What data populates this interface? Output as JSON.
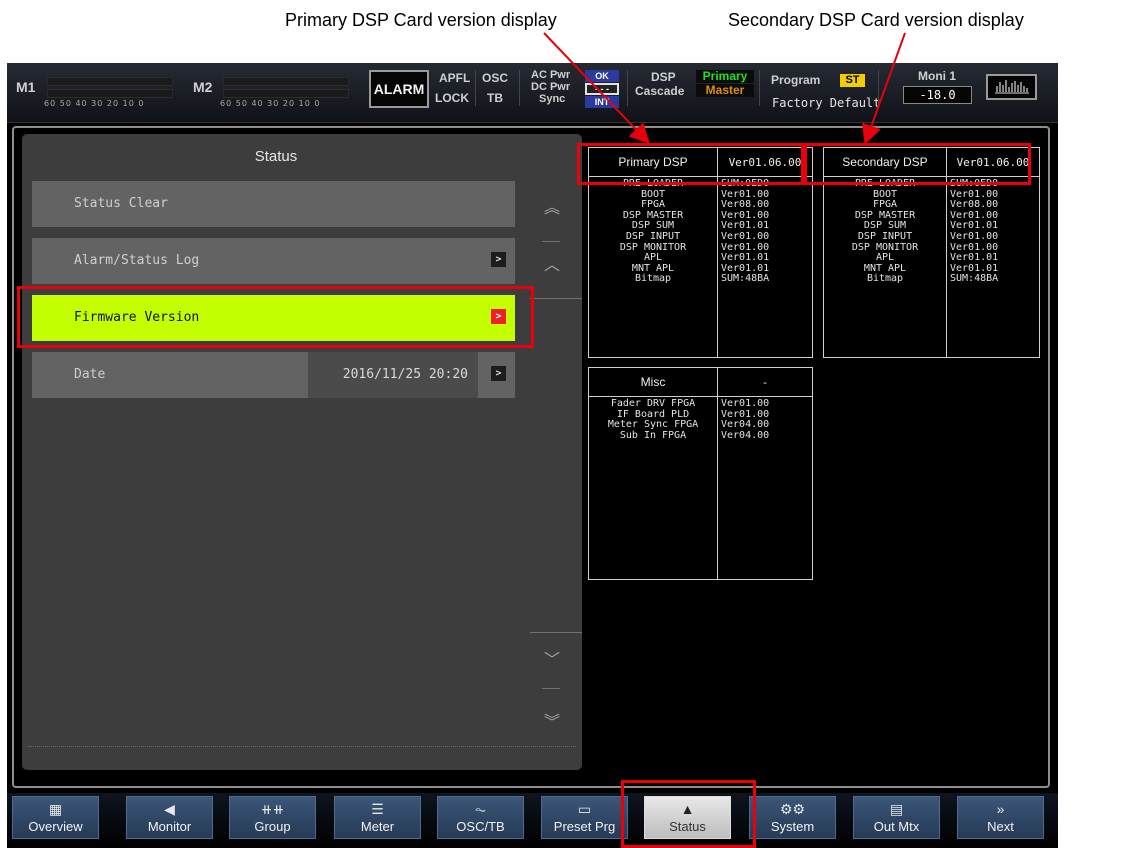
{
  "annotations": {
    "primary_label": "Primary DSP Card version display",
    "secondary_label": "Secondary DSP Card version display"
  },
  "header": {
    "m1": "M1",
    "m2": "M2",
    "meter_scale": "60 50 40 30 20 10  0",
    "alarm": "ALARM",
    "apfl": "APFL",
    "osc": "OSC",
    "lock": "LOCK",
    "tb": "TB",
    "ac_pwr": "AC Pwr",
    "dc_pwr": "DC Pwr",
    "sync": "Sync",
    "ac_ind": "OK",
    "dc_ind": "- - -",
    "sync_ind": "INT",
    "dsp": "DSP",
    "cascade": "Cascade",
    "dsp_state": "Primary",
    "cascade_state": "Master",
    "program": "Program",
    "program_mode": "ST",
    "preset_name": "Factory Default",
    "moni": "Moni 1",
    "moni_value": "-18.0",
    "wave_icon": "waveform-icon"
  },
  "status_panel": {
    "title": "Status",
    "items": [
      {
        "label": "Status Clear"
      },
      {
        "label": "Alarm/Status Log"
      },
      {
        "label": "Firmware Version"
      },
      {
        "label": "Date",
        "value": "2016/11/25 20:20"
      }
    ],
    "arrow_icon": "chevron-right-icon"
  },
  "primary_dsp": {
    "header": "Primary DSP",
    "header_version": "Ver01.06.00",
    "names": [
      "PRE LOADER",
      "BOOT",
      "FPGA",
      "DSP MASTER",
      "DSP SUM",
      "DSP INPUT",
      "DSP MONITOR",
      "APL",
      "MNT APL",
      "Bitmap"
    ],
    "versions": [
      "SUM:0ED0",
      "Ver01.00",
      "Ver08.00",
      "Ver01.00",
      "Ver01.01",
      "Ver01.00",
      "Ver01.00",
      "Ver01.01",
      "Ver01.01",
      "SUM:48BA"
    ]
  },
  "secondary_dsp": {
    "header": "Secondary DSP",
    "header_version": "Ver01.06.00",
    "names": [
      "PRE LOADER",
      "BOOT",
      "FPGA",
      "DSP MASTER",
      "DSP SUM",
      "DSP INPUT",
      "DSP MONITOR",
      "APL",
      "MNT APL",
      "Bitmap"
    ],
    "versions": [
      "SUM:0ED0",
      "Ver01.00",
      "Ver08.00",
      "Ver01.00",
      "Ver01.01",
      "Ver01.00",
      "Ver01.00",
      "Ver01.01",
      "Ver01.01",
      "SUM:48BA"
    ]
  },
  "misc": {
    "header": "Misc",
    "header_version": "-",
    "names": [
      "Fader DRV FPGA",
      "IF Board PLD",
      "Meter Sync FPGA",
      "Sub In FPGA"
    ],
    "versions": [
      "Ver01.00",
      "Ver01.00",
      "Ver04.00",
      "Ver04.00"
    ]
  },
  "tabs": [
    {
      "label": "Overview",
      "icon": "grid-icon",
      "glyph": "▦"
    },
    {
      "label": "Monitor",
      "icon": "speaker-icon",
      "glyph": "◀"
    },
    {
      "label": "Group",
      "icon": "faders-icon",
      "glyph": "⧺⧺"
    },
    {
      "label": "Meter",
      "icon": "meter-icon",
      "glyph": "☰"
    },
    {
      "label": "OSC/TB",
      "icon": "osc-icon",
      "glyph": "⏦"
    },
    {
      "label": "Preset Prg",
      "icon": "preset-icon",
      "glyph": "▭"
    },
    {
      "label": "Status",
      "icon": "warning-icon",
      "glyph": "▲"
    },
    {
      "label": "System",
      "icon": "gears-icon",
      "glyph": "⚙⚙"
    },
    {
      "label": "Out Mtx",
      "icon": "matrix-icon",
      "glyph": "▤"
    },
    {
      "label": "Next",
      "icon": "next-icon",
      "glyph": "»"
    }
  ]
}
